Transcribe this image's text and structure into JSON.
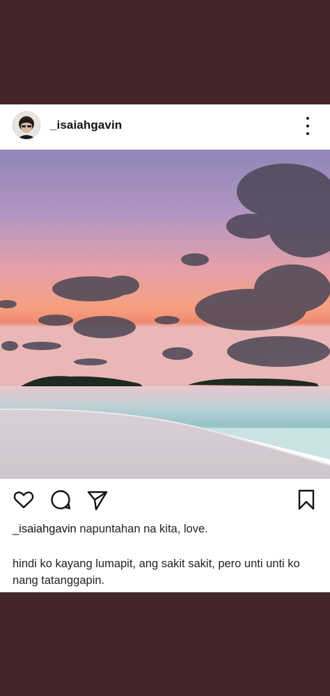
{
  "post": {
    "username": "_isaiahgavin",
    "caption": {
      "username": "_isaiahgavin",
      "first_line": "napuntahan na kita, love.",
      "body": "hindi ko kayang lumapit, ang sakit sakit, pero unti unti ko nang tatanggapin."
    },
    "actions": {
      "like_icon": "heart-outline-icon",
      "comment_icon": "speech-bubble-icon",
      "share_icon": "paper-plane-icon",
      "save_icon": "bookmark-icon"
    },
    "menu_icon": "vertical-ellipsis-icon",
    "photo_subject": "sunset beach with islands"
  },
  "colors": {
    "background_band": "#432626",
    "card": "#ffffff",
    "text": "#111111"
  }
}
